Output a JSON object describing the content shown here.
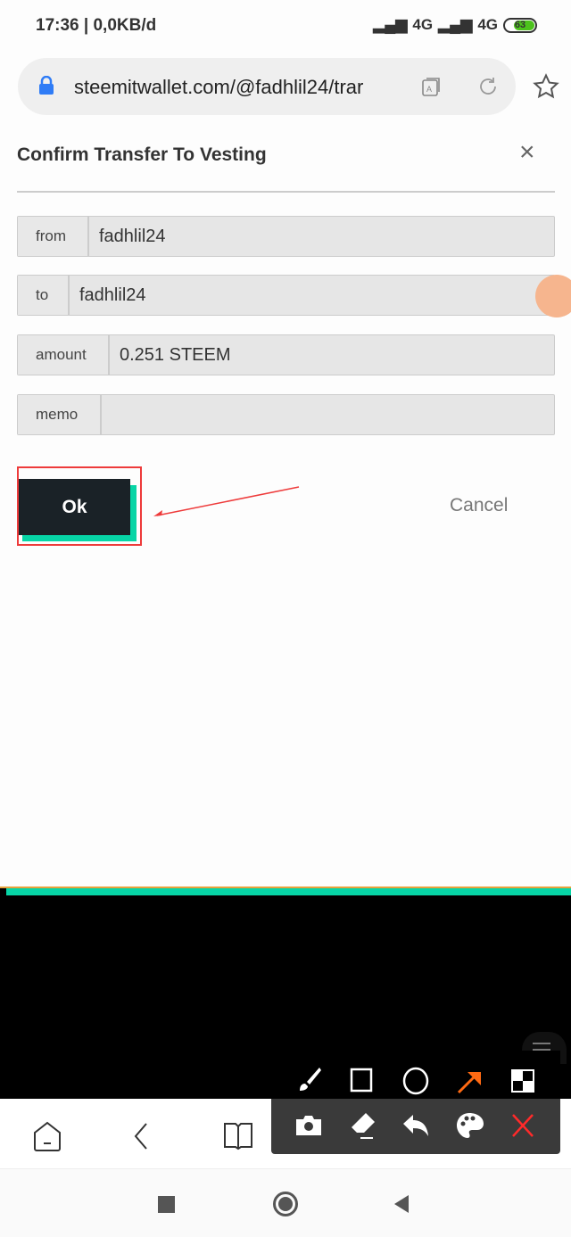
{
  "status_bar": {
    "time": "17:36 | 0,0KB/d",
    "network1": "4G",
    "network2": "4G",
    "battery": "63",
    "battery_color": "#4cc21c"
  },
  "browser": {
    "url": "steemitwallet.com/@fadhlil24/trar",
    "lock_color": "#2f7cf6"
  },
  "dialog": {
    "title": "Confirm Transfer To Vesting",
    "fields": [
      {
        "label": "from",
        "value": "fadhlil24"
      },
      {
        "label": "to",
        "value": "fadhlil24"
      },
      {
        "label": "amount",
        "value": "0.251 STEEM"
      },
      {
        "label": "memo",
        "value": ""
      }
    ],
    "ok_label": "Ok",
    "cancel_label": "Cancel",
    "accent": "#07d5a6"
  },
  "annotation_tools": [
    "brush-icon",
    "rectangle-icon",
    "circle-icon",
    "arrow-icon",
    "mosaic-icon",
    "camera-icon",
    "eraser-icon",
    "undo-icon",
    "palette-icon",
    "close-icon"
  ],
  "bottom_nav": [
    "home-icon",
    "back-icon",
    "bookmarks-icon"
  ],
  "system_nav": [
    "recents-icon",
    "home-icon",
    "back-icon"
  ]
}
